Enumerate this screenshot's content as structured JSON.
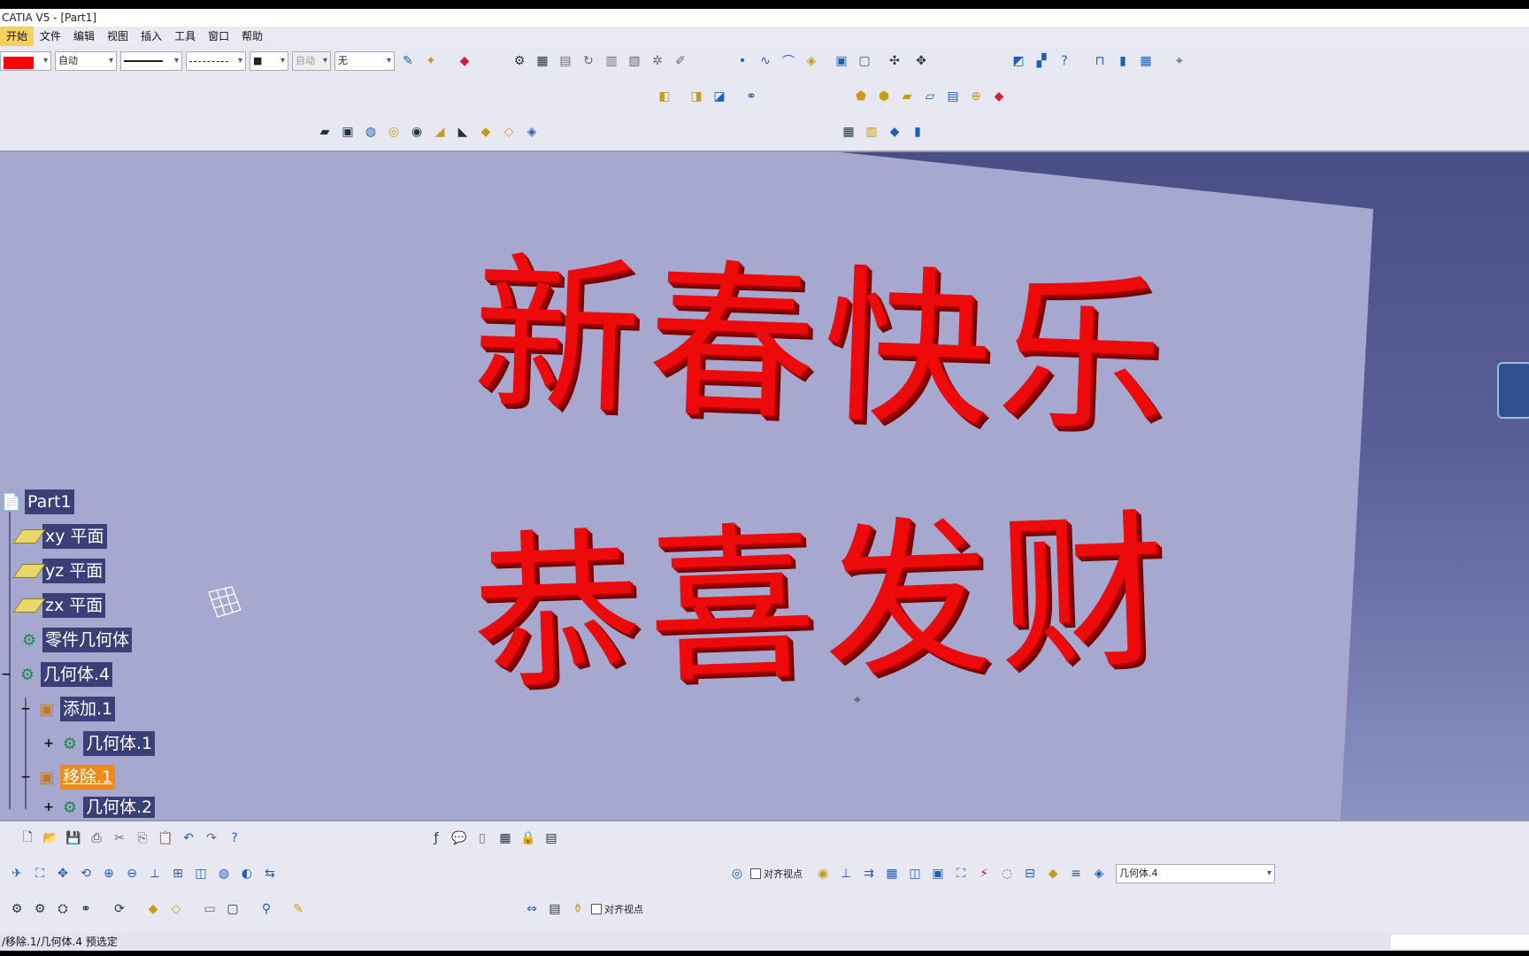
{
  "window": {
    "title": "CATIA V5 - [Part1]"
  },
  "menu": [
    "开始",
    "文件",
    "编辑",
    "视图",
    "插入",
    "工具",
    "窗口",
    "帮助"
  ],
  "properties": {
    "color_hex": "#ff0000",
    "transparency": "自动",
    "line_type": "无",
    "disabled_label": "自动"
  },
  "viewport": {
    "line1": "新春快乐",
    "line2": "恭喜发财"
  },
  "tree": {
    "root": "Part1",
    "items": [
      {
        "label": "xy 平面",
        "icon": "plane-icon"
      },
      {
        "label": "yz 平面",
        "icon": "plane-icon"
      },
      {
        "label": "zx 平面",
        "icon": "plane-icon"
      },
      {
        "label": "零件几何体",
        "icon": "gear-icon"
      },
      {
        "label": "几何体.4",
        "icon": "body-icon"
      },
      {
        "label": "添加.1",
        "icon": "add-icon"
      },
      {
        "label": "几何体.1",
        "icon": "body-icon"
      },
      {
        "label": "移除.1",
        "icon": "remove-icon"
      },
      {
        "label": "几何体.2",
        "icon": "body-icon"
      }
    ]
  },
  "bottom": {
    "align_view_1": "对齐视点",
    "align_view_2": "对齐视点",
    "current_body": "几何体.4"
  },
  "status": {
    "text": "/移除.1/几何体.4 预选定"
  }
}
